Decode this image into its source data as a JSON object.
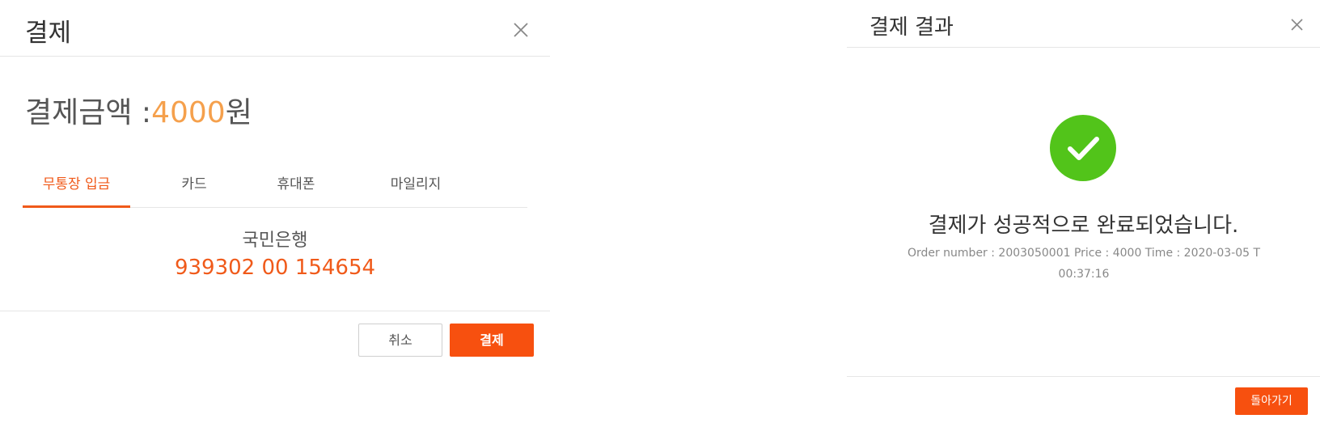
{
  "payment_dialog": {
    "title": "결제",
    "amount_label": "결제금액 :",
    "amount_value": "4000",
    "amount_unit": "원",
    "tabs": [
      {
        "label": "무통장 입금",
        "active": true
      },
      {
        "label": "카드",
        "active": false
      },
      {
        "label": "휴대폰",
        "active": false
      },
      {
        "label": "마일리지",
        "active": false
      }
    ],
    "bank_name": "국민은행",
    "bank_account": "939302 00 154654",
    "cancel_label": "취소",
    "pay_label": "결제"
  },
  "result_dialog": {
    "title": "결제 결과",
    "success_message": "결제가 성공적으로 완료되었습니다.",
    "order_info_line1": "Order number : 2003050001 Price : 4000 Time : 2020-03-05 T",
    "order_info_line2": "00:37:16",
    "back_label": "돌아가기"
  },
  "colors": {
    "accent": "#f7500f",
    "accent_text": "#f05a1a",
    "amount": "#f5a04c",
    "success": "#52c41a"
  },
  "icons": {
    "close": "close-icon",
    "success": "check-circle-icon"
  }
}
